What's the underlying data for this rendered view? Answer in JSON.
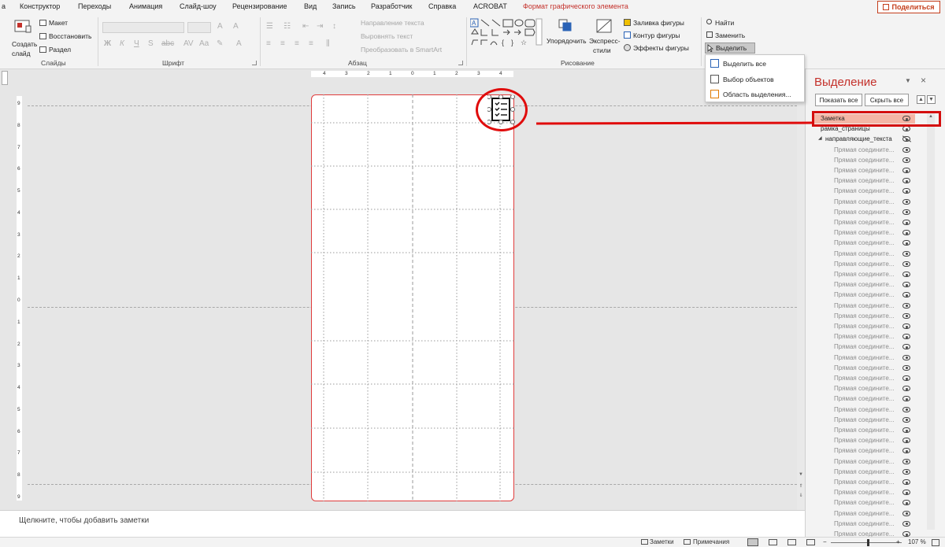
{
  "menu": {
    "tabs": [
      "а",
      "Конструктор",
      "Переходы",
      "Анимация",
      "Слайд-шоу",
      "Рецензирование",
      "Вид",
      "Запись",
      "Разработчик",
      "Справка",
      "ACROBAT",
      "Формат графического элемента"
    ],
    "share": "Поделиться"
  },
  "ribbon": {
    "slides": {
      "create_slide_1": "Создать",
      "create_slide_2": "слайд",
      "layout": "Макет",
      "reset": "Восстановить",
      "section": "Раздел",
      "group": "Слайды"
    },
    "font": {
      "group": "Шрифт"
    },
    "paragraph": {
      "text_direction": "Направление текста",
      "align_text": "Выровнять текст",
      "convert_smartart": "Преобразовать в SmartArt",
      "group": "Абзац"
    },
    "drawing": {
      "arrange_1": "Упорядочить",
      "quick_styles_1": "Экспресс-",
      "quick_styles_2": "стили",
      "shape_fill": "Заливка фигуры",
      "shape_outline": "Контур фигуры",
      "shape_effects": "Эффекты фигуры",
      "group": "Рисование"
    },
    "editing": {
      "find": "Найти",
      "replace": "Заменить",
      "select": "Выделить"
    }
  },
  "select_menu": {
    "items": [
      "Выделить все",
      "Выбор объектов",
      "Область выделения..."
    ]
  },
  "ruler": {
    "h_labels": [
      "4",
      "3",
      "2",
      "1",
      "0",
      "1",
      "2",
      "3",
      "4"
    ],
    "v_labels": [
      "9",
      "8",
      "7",
      "6",
      "5",
      "4",
      "3",
      "2",
      "1",
      "0",
      "1",
      "2",
      "3",
      "4",
      "5",
      "6",
      "7",
      "8",
      "9"
    ]
  },
  "notes": {
    "placeholder": "Щелкните, чтобы добавить заметки"
  },
  "status": {
    "notes": "Заметки",
    "comments": "Примечания",
    "zoom": "107 %"
  },
  "selection_pane": {
    "title": "Выделение",
    "show_all": "Показать все",
    "hide_all": "Скрыть все",
    "items": [
      {
        "label": "Заметка",
        "level": 0,
        "selected": true
      },
      {
        "label": "рамка_страницы",
        "level": 0
      },
      {
        "label": "направляющие_текста",
        "level": 0,
        "group": true,
        "hidden": true
      },
      {
        "label": "Прямая соедините...",
        "level": 1
      },
      {
        "label": "Прямая соедините...",
        "level": 1
      },
      {
        "label": "Прямая соедините...",
        "level": 1
      },
      {
        "label": "Прямая соедините...",
        "level": 1
      },
      {
        "label": "Прямая соедините...",
        "level": 1
      },
      {
        "label": "Прямая соедините...",
        "level": 1
      },
      {
        "label": "Прямая соедините...",
        "level": 1
      },
      {
        "label": "Прямая соедините...",
        "level": 1
      },
      {
        "label": "Прямая соедините...",
        "level": 1
      },
      {
        "label": "Прямая соедините...",
        "level": 1
      },
      {
        "label": "Прямая соедините...",
        "level": 1
      },
      {
        "label": "Прямая соедините...",
        "level": 1
      },
      {
        "label": "Прямая соедините...",
        "level": 1
      },
      {
        "label": "Прямая соедините...",
        "level": 1
      },
      {
        "label": "Прямая соедините...",
        "level": 1
      },
      {
        "label": "Прямая соедините...",
        "level": 1
      },
      {
        "label": "Прямая соедините...",
        "level": 1
      },
      {
        "label": "Прямая соедините...",
        "level": 1
      },
      {
        "label": "Прямая соедините...",
        "level": 1
      },
      {
        "label": "Прямая соедините...",
        "level": 1
      },
      {
        "label": "Прямая соедините...",
        "level": 1
      },
      {
        "label": "Прямая соедините...",
        "level": 1
      },
      {
        "label": "Прямая соедините...",
        "level": 1
      },
      {
        "label": "Прямая соедините...",
        "level": 1
      },
      {
        "label": "Прямая соедините...",
        "level": 1
      },
      {
        "label": "Прямая соедините...",
        "level": 1
      },
      {
        "label": "Прямая соедините...",
        "level": 1
      },
      {
        "label": "Прямая соедините...",
        "level": 1
      },
      {
        "label": "Прямая соедините...",
        "level": 1
      },
      {
        "label": "Прямая соедините...",
        "level": 1
      },
      {
        "label": "Прямая соедините...",
        "level": 1
      },
      {
        "label": "Прямая соедините...",
        "level": 1
      },
      {
        "label": "Прямая соедините...",
        "level": 1
      },
      {
        "label": "Прямая соедините...",
        "level": 1
      },
      {
        "label": "Прямая соедините...",
        "level": 1
      },
      {
        "label": "Прямая соедините...",
        "level": 1
      },
      {
        "label": "Прямая соедините...",
        "level": 1
      },
      {
        "label": "Прямая соедините...",
        "level": 1
      },
      {
        "label": "Прямая соедините...",
        "level": 1
      },
      {
        "label": "Прямая соедините...",
        "level": 1
      },
      {
        "label": "Прямая соедините...",
        "level": 1
      }
    ]
  },
  "colors": {
    "accent": "#c4312b",
    "annotation": "#e00c0c",
    "selected_row": "#f4b6a6",
    "slide_border": "#e03c3c"
  },
  "icons": {
    "slide_object": "checklist-icon",
    "find": "search-icon",
    "select": "cursor-icon"
  }
}
